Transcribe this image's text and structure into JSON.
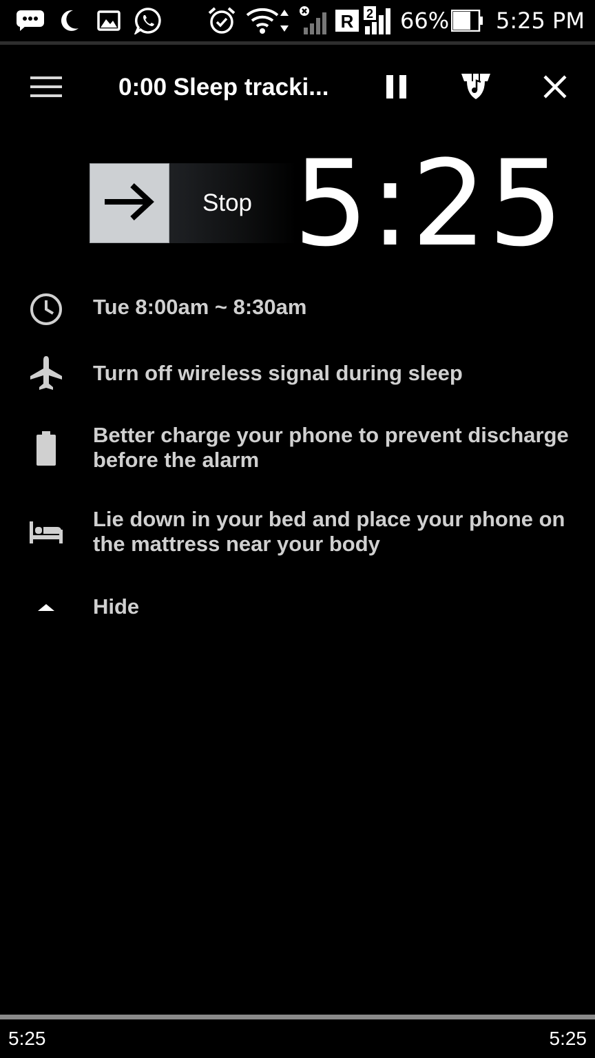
{
  "status_bar": {
    "battery_percent": "66%",
    "time": "5:25 PM",
    "sim_label": "R",
    "sim_slot": "2",
    "icons": [
      "chat-icon",
      "moon-icon",
      "gallery-icon",
      "whatsapp-icon",
      "alarm-icon",
      "wifi-icon",
      "signal-icon",
      "battery-icon"
    ]
  },
  "toolbar": {
    "title": "0:00 Sleep tracki...",
    "icons": [
      "menu-icon",
      "pause-icon",
      "lullaby-icon",
      "close-icon"
    ]
  },
  "stop_slider": {
    "label": "Stop",
    "icon": "arrow-right-icon"
  },
  "clock": {
    "time": "5:25"
  },
  "info": [
    {
      "icon": "clock-icon",
      "text": "Tue 8:00am ~ 8:30am"
    },
    {
      "icon": "airplane-icon",
      "text": "Turn off wireless signal during sleep"
    },
    {
      "icon": "battery-icon",
      "text": "Better charge your phone to prevent discharge before the alarm"
    },
    {
      "icon": "bed-icon",
      "text": "Lie down in your bed and place your phone on the mattress near your body"
    },
    {
      "icon": "triangle-up-icon",
      "text": "Hide"
    }
  ],
  "bottom_bar": {
    "left_time": "5:25",
    "right_time": "5:25"
  },
  "colors": {
    "background": "#000000",
    "text_primary": "#ffffff",
    "text_secondary": "#d0d0d0",
    "slider_handle": "#cdd0d3"
  }
}
